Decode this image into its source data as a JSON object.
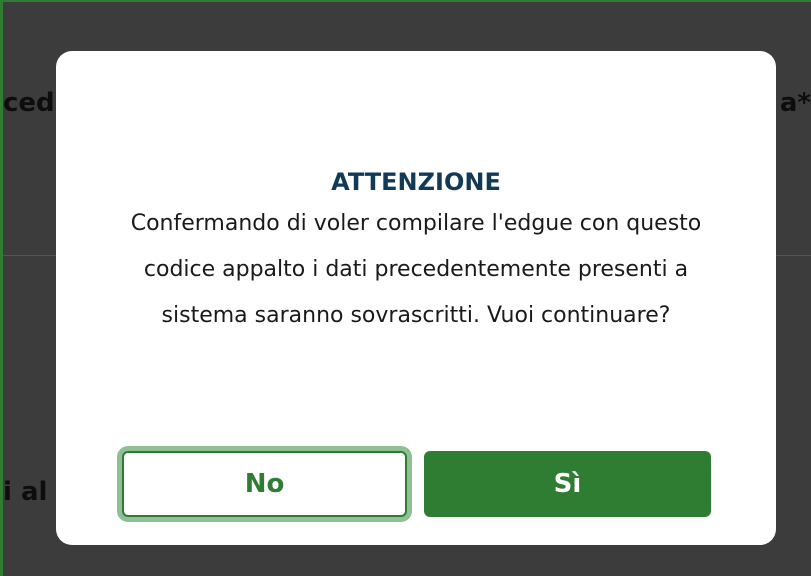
{
  "background": {
    "left_text_top": "ced",
    "right_text_top": "a*",
    "left_text_bottom": "i al"
  },
  "dialog": {
    "title": "ATTENZIONE",
    "message": "Confermando di voler compilare l'edgue con questo codice appalto i dati precedentemente presenti a sistema saranno sovrascritti. Vuoi continuare?",
    "no_label": "No",
    "yes_label": "Sì"
  },
  "colors": {
    "primary_green": "#2e7d32",
    "title_blue": "#123a57",
    "backdrop": "#3c3c3c",
    "focus_ring": "#8fbf95"
  }
}
